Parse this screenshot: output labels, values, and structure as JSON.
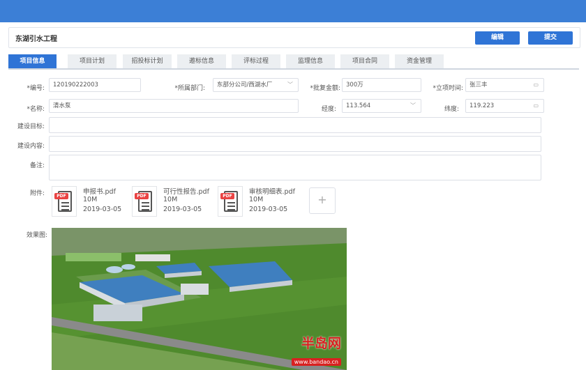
{
  "header": {
    "project_title": "东湖引水工程",
    "edit_label": "编辑",
    "submit_label": "提交"
  },
  "tabs": [
    {
      "label": "项目信息",
      "active": true
    },
    {
      "label": "项目计划"
    },
    {
      "label": "招投标计划"
    },
    {
      "label": "邀标信息"
    },
    {
      "label": "评标过程"
    },
    {
      "label": "监理信息"
    },
    {
      "label": "项目合同"
    },
    {
      "label": "资金管理"
    }
  ],
  "form": {
    "code_label": "*编号:",
    "code_value": "120190222003",
    "dept_label": "*所属部门:",
    "dept_value": "东部分公司/西湖水厂",
    "amount_label": "*批复金额:",
    "amount_value": "300万",
    "date_label": "*立项时间:",
    "date_value": "张三丰",
    "name_label": "*名称:",
    "name_value": "清水泵",
    "lng_label": "经度:",
    "lng_value": "113.564",
    "lat_label": "纬度:",
    "lat_value": "119.223",
    "goal_label": "建设目标:",
    "content_label": "建设内容:",
    "note_label": "备注:",
    "attach_label": "附件:",
    "render_label": "效果图:"
  },
  "attachments": [
    {
      "name": "申报书.pdf",
      "size": "10M",
      "date": "2019-03-05",
      "tag": "PDF"
    },
    {
      "name": "可行性报告.pdf",
      "size": "10M",
      "date": "2019-03-05",
      "tag": "PDF"
    },
    {
      "name": "审核明细表.pdf",
      "size": "10M",
      "date": "2019-03-05",
      "tag": "PDF"
    }
  ],
  "add_symbol": "+",
  "watermark": {
    "text": "半岛网",
    "url": "www.bandao.cn"
  },
  "icons": {
    "dropdown": "chevron-down-icon",
    "calendar": "calendar-icon",
    "add": "plus-icon",
    "file": "pdf-file-icon"
  },
  "colors": {
    "topbar": "#3c7fd6",
    "primary": "#2f74d6",
    "pdf_red": "#e94343"
  }
}
